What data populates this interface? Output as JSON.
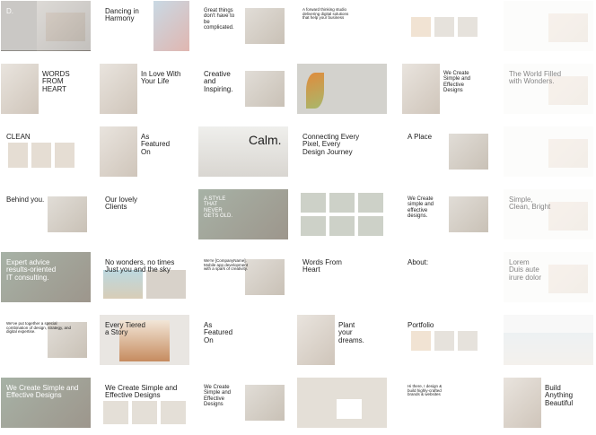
{
  "colors": {
    "bg": "#ffffff",
    "tile_light": "#f4f3f1",
    "photo_warm": "#d8cdc1",
    "photo_gray": "#c9c9c4",
    "accent_orange": "#e5813f",
    "text": "#1d1d1d"
  },
  "tiles": [
    {
      "text": "D.",
      "style": "dark-photo"
    },
    {
      "text": "Dancing in\nHarmony",
      "style": "split-photo"
    },
    {
      "text": "Great things\ndon't have to\nbe\ncomplicated.",
      "style": "text-photo"
    },
    {
      "text": "A forward thinking studio\ndelivering digital solutions\nthat help your business",
      "style": "text"
    },
    {
      "text": "",
      "style": "products"
    },
    {
      "text": "",
      "style": "faded"
    },
    {
      "text": "WORDS FROM\nHEART",
      "style": "photo-text"
    },
    {
      "text": "In Love With\nYour Life",
      "style": "photo-text"
    },
    {
      "text": "Creative\nand\nInspiring.",
      "style": "text-photo"
    },
    {
      "text": "",
      "style": "leaf"
    },
    {
      "text": "We Create\nSimple and\nEffective\nDesigns",
      "style": "photo-text"
    },
    {
      "text": "The World Filled\nwith Wonders.",
      "style": "faded"
    },
    {
      "text": "CLEAN",
      "style": "grid-photos"
    },
    {
      "text": "As\nFeatured\nOn",
      "style": "photo-text"
    },
    {
      "text": "Calm.",
      "style": "photo-big"
    },
    {
      "text": "Connecting Every\nPixel, Every\nDesign Journey",
      "style": "text"
    },
    {
      "text": "A Place",
      "style": "text-photo"
    },
    {
      "text": "",
      "style": "faded"
    },
    {
      "text": "Behind you.",
      "style": "text-photo"
    },
    {
      "text": "Our lovely\nClients",
      "style": "text"
    },
    {
      "text": "A STYLE\nTHAT\nNEVER\nGETS OLD.",
      "style": "photo-overlay"
    },
    {
      "text": "",
      "style": "collage"
    },
    {
      "text": "We Create\nsimple and\neffective\ndesigns.",
      "style": "text-photo"
    },
    {
      "text": "Simple,\nClean, Bright",
      "style": "faded"
    },
    {
      "text": "Expert advice\nresults-oriented\nIT consulting.",
      "style": "photo-overlay"
    },
    {
      "text": "No wonders, no times\nJust you and the sky",
      "style": "photos"
    },
    {
      "text": "We're [CompanyName].\nMobile app development\nwith a spark of creativity.",
      "style": "text-photo"
    },
    {
      "text": "Words From\nHeart",
      "style": "text"
    },
    {
      "text": "About:",
      "style": "text"
    },
    {
      "text": "Lorem\nDuis aute\nirure dolor",
      "style": "faded"
    },
    {
      "text": "We've put together a special\ncombination of design, strategy, and\ndigital expertise.",
      "style": "text-photo"
    },
    {
      "text": "Every Tiered\na Story",
      "style": "cake"
    },
    {
      "text": "As\nFeatured\nOn",
      "style": "text"
    },
    {
      "text": "Plant\nyour\ndreams.",
      "style": "photo-text"
    },
    {
      "text": "Portfolio",
      "style": "products"
    },
    {
      "text": "",
      "style": "sea-faded"
    },
    {
      "text": "We Create Simple and\nEffective Designs",
      "style": "photo-overlay"
    },
    {
      "text": "We Create Simple and\nEffective Designs",
      "style": "text-photos"
    },
    {
      "text": "We Create\nSimple and\nEffective\nDesigns",
      "style": "text-photo"
    },
    {
      "text": "",
      "style": "lamp"
    },
    {
      "text": "Hi there, I design &\nbuild highly-crafted\nbrands & websites",
      "style": "text"
    },
    {
      "text": "Build\nAnything\nBeautiful",
      "style": "photo-text"
    },
    {
      "text": "",
      "style": "faded"
    }
  ]
}
